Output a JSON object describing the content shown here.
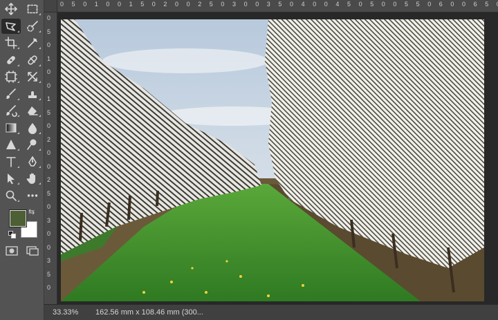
{
  "toolbar": {
    "tools": [
      {
        "name": "move-tool",
        "icon": "move-icon"
      },
      {
        "name": "marquee-tool",
        "icon": "rectangular-marquee-icon"
      },
      {
        "name": "lasso-tool",
        "icon": "polygonal-lasso-icon",
        "active": true
      },
      {
        "name": "quick-selection-tool",
        "icon": "quick-selection-brush-icon"
      },
      {
        "name": "crop-tool",
        "icon": "crop-icon"
      },
      {
        "name": "eyedropper-tool",
        "icon": "eyedropper-icon"
      },
      {
        "name": "spot-healing-tool",
        "icon": "healing-bandage-icon"
      },
      {
        "name": "patch-tool",
        "icon": "patch-bandage-icon"
      },
      {
        "name": "frame-tool",
        "icon": "frame-icon"
      },
      {
        "name": "content-aware-move-tool",
        "icon": "content-aware-move-icon"
      },
      {
        "name": "brush-tool",
        "icon": "brush-icon"
      },
      {
        "name": "clone-stamp-tool",
        "icon": "stamp-icon"
      },
      {
        "name": "history-brush-tool",
        "icon": "history-brush-icon"
      },
      {
        "name": "eraser-tool",
        "icon": "eraser-icon"
      },
      {
        "name": "gradient-tool",
        "icon": "gradient-icon"
      },
      {
        "name": "blur-tool",
        "icon": "blur-drop-icon"
      },
      {
        "name": "sharpen-tool",
        "icon": "sharpen-triangle-icon"
      },
      {
        "name": "dodge-tool",
        "icon": "dodge-icon"
      },
      {
        "name": "type-tool",
        "icon": "type-icon"
      },
      {
        "name": "pen-tool",
        "icon": "pen-icon"
      },
      {
        "name": "path-selection-tool",
        "icon": "arrow-cursor-icon"
      },
      {
        "name": "hand-tool",
        "icon": "hand-icon"
      },
      {
        "name": "zoom-tool",
        "icon": "magnifier-icon"
      },
      {
        "name": "more-tools",
        "icon": "ellipsis-icon"
      }
    ],
    "colors": {
      "foreground": "#4d5f35",
      "background": "#ffffff"
    }
  },
  "rulers": {
    "top": [
      "0",
      "5",
      "0",
      "1",
      "0",
      "0",
      "1",
      "5",
      "0",
      "2",
      "0",
      "0",
      "2",
      "5",
      "0",
      "3",
      "0",
      "0",
      "3",
      "5",
      "0",
      "4",
      "0",
      "0",
      "4",
      "5",
      "0",
      "5",
      "0",
      "0",
      "5",
      "5",
      "0",
      "6",
      "0",
      "0",
      "6",
      "5",
      "0"
    ],
    "left": [
      "0",
      "5",
      "0",
      "1",
      "0",
      "0",
      "1",
      "5",
      "0",
      "2",
      "0",
      "0",
      "2",
      "5",
      "0",
      "3",
      "0",
      "0",
      "3",
      "5",
      "0"
    ]
  },
  "status": {
    "zoom": "33.33%",
    "doc_size": "162.56 mm x 108.46 mm (300..."
  }
}
